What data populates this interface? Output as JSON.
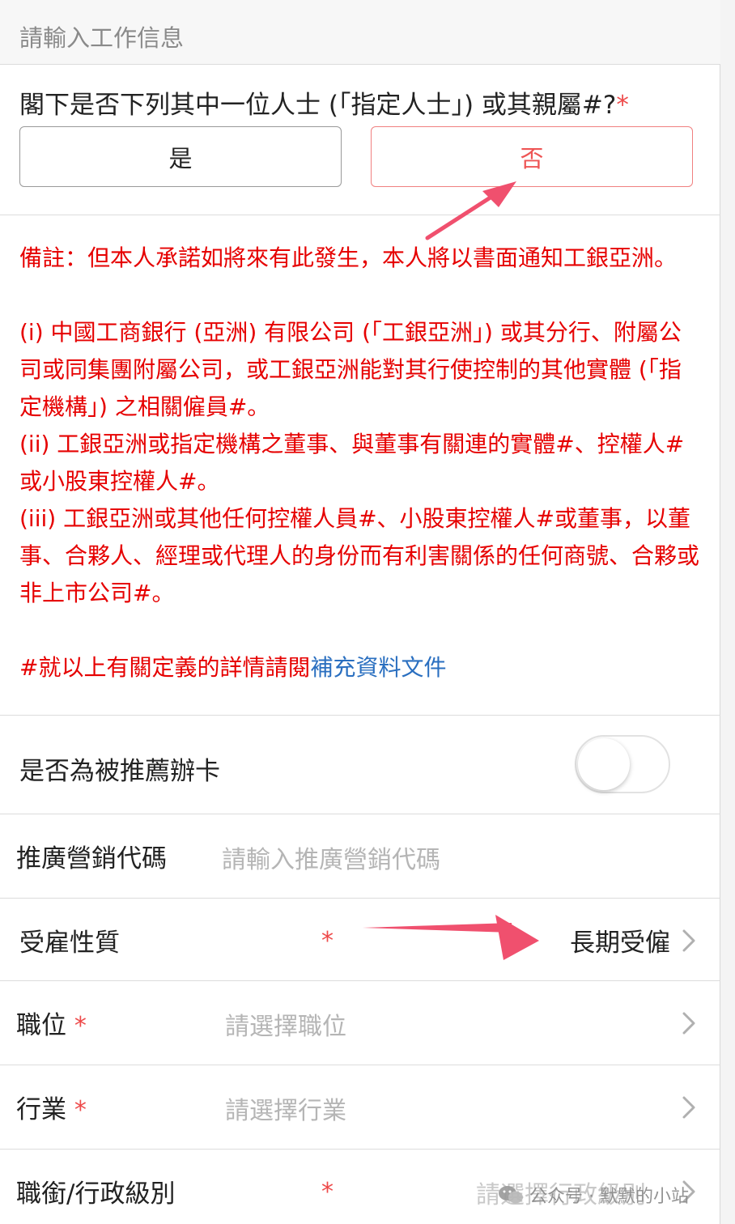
{
  "header": {
    "placeholder": "請輸入工作信息"
  },
  "question": {
    "text": "閣下是否下列其中一位人士 (「指定人士」) 或其親屬#?",
    "required_mark": "*",
    "options": [
      "是",
      "否"
    ],
    "selected": "否"
  },
  "notes": {
    "line1": "備註：但本人承諾如將來有此發生，本人將以書面通知工銀亞洲。",
    "item1": "(i) 中國工商銀行 (亞洲) 有限公司 (「工銀亞洲」) 或其分行、附屬公司或同集團附屬公司，或工銀亞洲能對其行使控制的其他實體 (「指定機構」) 之相關僱員#。",
    "item2": "(ii) 工銀亞洲或指定機構之董事、與董事有關連的實體#、控權人#或小股東控權人#。",
    "item3": "(iii) 工銀亞洲或其他任何控權人員#、小股東控權人#或董事，以董事、合夥人、經理或代理人的身份而有利害關係的任何商號、合夥或非上市公司#。",
    "footer_text": "#就以上有關定義的詳情請閱",
    "footer_link": "補充資料文件"
  },
  "referral": {
    "label": "是否為被推薦辦卡",
    "enabled": false
  },
  "promo_code": {
    "label": "推廣營銷代碼",
    "placeholder": "請輸入推廣營銷代碼"
  },
  "employment_type": {
    "label": "受雇性質",
    "required_mark": "*",
    "value": "長期受僱"
  },
  "position": {
    "label": "職位",
    "required_mark": "*",
    "placeholder": "請選擇職位"
  },
  "industry": {
    "label": "行業",
    "required_mark": "*",
    "placeholder": "請選擇行業"
  },
  "rank": {
    "label": "職銜/行政級別",
    "required_mark": "*",
    "placeholder": "請選擇行政級別"
  },
  "watermark": {
    "text": "公众号 · 默默的小站"
  },
  "colors": {
    "accent_red": "#e60000",
    "link_blue": "#2a6fc0",
    "arrow_red": "#f0506e"
  }
}
